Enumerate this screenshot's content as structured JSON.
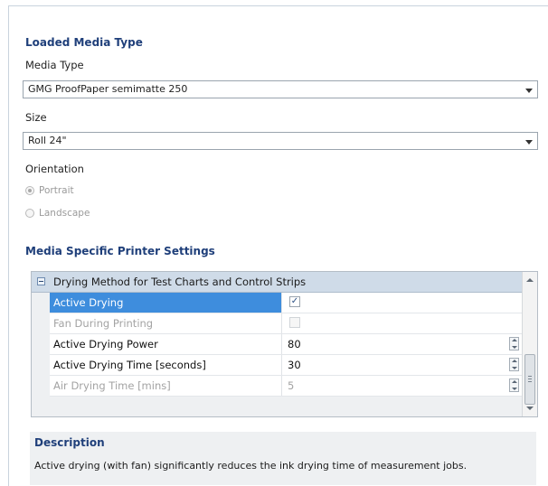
{
  "loaded_media": {
    "title": "Loaded Media Type",
    "media_type_label": "Media Type",
    "media_type_value": "GMG ProofPaper semimatte 250",
    "size_label": "Size",
    "size_value": "Roll 24\"",
    "orientation_label": "Orientation",
    "orientation_options": [
      {
        "label": "Portrait",
        "selected": true
      },
      {
        "label": "Landscape",
        "selected": false
      }
    ]
  },
  "printer_settings": {
    "title": "Media Specific Printer Settings",
    "group_label": "Drying Method for Test Charts and Control Strips",
    "rows": [
      {
        "name": "Active Drying",
        "value_type": "checkbox",
        "checked": true,
        "enabled": true,
        "selected": true
      },
      {
        "name": "Fan During Printing",
        "value_type": "checkbox",
        "checked": false,
        "enabled": false,
        "selected": false
      },
      {
        "name": "Active Drying Power",
        "value": "80",
        "value_type": "spinner",
        "enabled": true,
        "selected": false
      },
      {
        "name": "Active Drying Time [seconds]",
        "value": "30",
        "value_type": "spinner",
        "enabled": true,
        "selected": false
      },
      {
        "name": "Air Drying Time [mins]",
        "value": "5",
        "value_type": "spinner",
        "enabled": false,
        "selected": false
      }
    ]
  },
  "description": {
    "title": "Description",
    "text": "Active drying (with fan) significantly reduces the ink drying time of measurement jobs."
  },
  "colors": {
    "section_heading": "#1f3f7a",
    "selected_row": "#3e8ddd",
    "group_header": "#cfdbe8",
    "panel_background": "#eef0f2"
  },
  "icons": {
    "dropdown": "chevron-down-icon",
    "collapse": "minus-box-icon",
    "checkmark": "check-icon",
    "spinner": "spin-arrows-icon",
    "scroll_up": "arrow-up-icon",
    "scroll_down": "arrow-down-icon"
  }
}
